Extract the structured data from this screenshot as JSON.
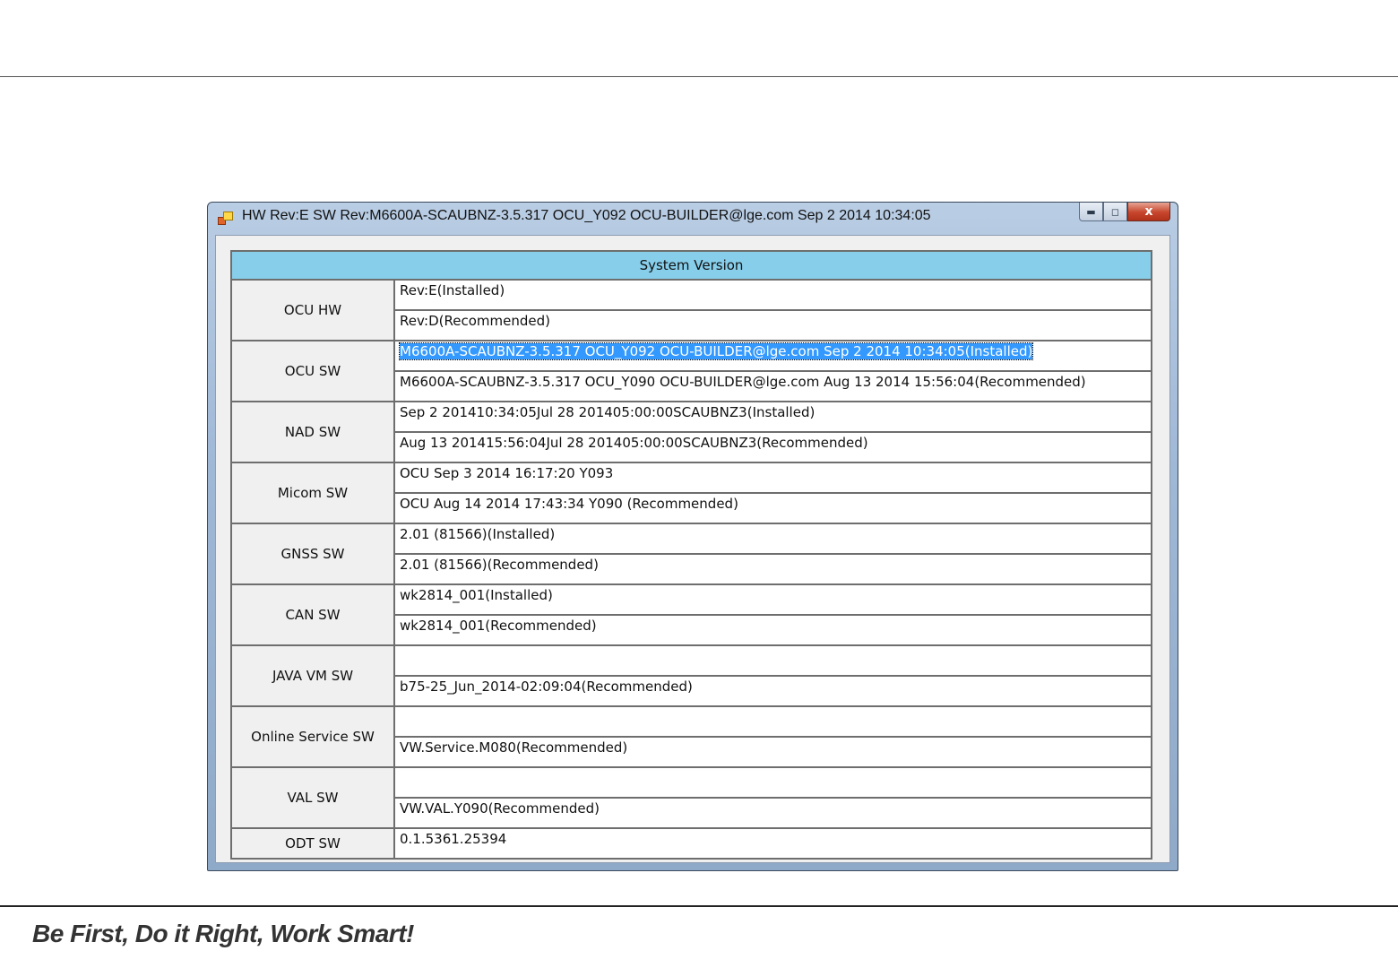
{
  "window": {
    "title": "HW Rev:E SW Rev:M6600A-SCAUBNZ-3.5.317 OCU_Y092 OCU-BUILDER@lge.com Sep  2 2014 10:34:05",
    "icon": "app-window-icon",
    "controls": {
      "minimize": "minimize-icon",
      "maximize": "maximize-icon",
      "close": "close-icon"
    },
    "close_glyph": "x"
  },
  "table": {
    "header": "System Version",
    "rows": [
      {
        "label": "OCU HW",
        "values": [
          "Rev:E(Installed)",
          "Rev:D(Recommended)"
        ]
      },
      {
        "label": "OCU SW",
        "values": [
          "M6600A-SCAUBNZ-3.5.317 OCU_Y092 OCU-BUILDER@lge.com Sep  2 2014 10:34:05(Installed)",
          "M6600A-SCAUBNZ-3.5.317 OCU_Y090 OCU-BUILDER@lge.com Aug 13 2014 15:56:04(Recommended)"
        ]
      },
      {
        "label": "NAD SW",
        "values": [
          "Sep  2 201410:34:05Jul 28 201405:00:00SCAUBNZ3(Installed)",
          "Aug 13 201415:56:04Jul 28 201405:00:00SCAUBNZ3(Recommended)"
        ]
      },
      {
        "label": "Micom SW",
        "values": [
          "OCU Sep  3 2014 16:17:20 Y093",
          "OCU Aug 14 2014 17:43:34 Y090 (Recommended)"
        ]
      },
      {
        "label": "GNSS SW",
        "values": [
          "2.01 (81566)(Installed)",
          "2.01 (81566)(Recommended)"
        ]
      },
      {
        "label": "CAN SW",
        "values": [
          "wk2814_001(Installed)",
          "wk2814_001(Recommended)"
        ]
      },
      {
        "label": "JAVA VM SW",
        "values": [
          "",
          "b75-25_Jun_2014-02:09:04(Recommended)"
        ]
      },
      {
        "label": "Online Service SW",
        "values": [
          "",
          "VW.Service.M080(Recommended)"
        ]
      },
      {
        "label": "VAL SW",
        "values": [
          "",
          "VW.VAL.Y090(Recommended)"
        ]
      },
      {
        "label": "ODT SW",
        "values": [
          "0.1.5361.25394"
        ]
      }
    ]
  },
  "slide": {
    "slogan": "Be First, Do it Right, Work Smart!"
  }
}
